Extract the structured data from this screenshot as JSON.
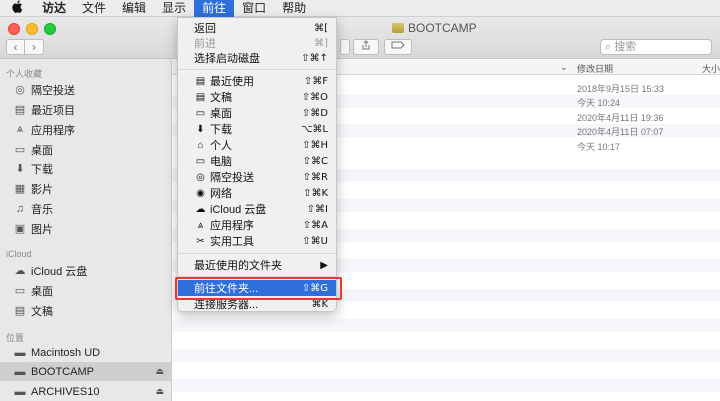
{
  "menubar": {
    "apple": "",
    "items": [
      "访达",
      "文件",
      "编辑",
      "显示",
      "前往",
      "窗口",
      "帮助"
    ]
  },
  "window": {
    "title": "BOOTCAMP",
    "search_placeholder": "搜索",
    "nav_back": "‹",
    "nav_forward": "›",
    "columns": {
      "date": "修改日期",
      "size": "大小"
    },
    "rows": [
      {
        "date": "2018年9月15日 15:33"
      },
      {
        "date": "今天 10:24"
      },
      {
        "date": "2020年4月11日 19:36"
      },
      {
        "date": "2020年4月11日 07:07"
      },
      {
        "date": "今天 10:17"
      }
    ]
  },
  "sidebar": {
    "favorites_title": "个人收藏",
    "favorites": [
      {
        "label": "隔空投送",
        "icon": "airdrop-icon"
      },
      {
        "label": "最近项目",
        "icon": "recents-icon"
      },
      {
        "label": "应用程序",
        "icon": "applications-icon"
      },
      {
        "label": "桌面",
        "icon": "desktop-icon"
      },
      {
        "label": "下载",
        "icon": "downloads-icon"
      },
      {
        "label": "影片",
        "icon": "movies-icon"
      },
      {
        "label": "音乐",
        "icon": "music-icon"
      },
      {
        "label": "图片",
        "icon": "pictures-icon"
      }
    ],
    "icloud_title": "iCloud",
    "icloud": [
      {
        "label": "iCloud 云盘",
        "icon": "cloud-icon"
      },
      {
        "label": "桌面",
        "icon": "desktop-icon"
      },
      {
        "label": "文稿",
        "icon": "documents-icon"
      }
    ],
    "locations_title": "位置",
    "locations": [
      {
        "label": "Macintosh UD",
        "icon": "drive-icon"
      },
      {
        "label": "BOOTCAMP",
        "icon": "drive-icon"
      },
      {
        "label": "ARCHIVES10",
        "icon": "drive-icon"
      }
    ],
    "eject": "⏏"
  },
  "menu": {
    "items": [
      {
        "label": "返回",
        "shortcut": "⌘[",
        "disabled": false
      },
      {
        "label": "前进",
        "shortcut": "⌘]",
        "disabled": true
      },
      {
        "label": "选择启动磁盘",
        "shortcut": "⇧⌘↑",
        "disabled": false
      },
      {
        "label": "最近使用",
        "shortcut": "⇧⌘F",
        "icon": "recents-icon"
      },
      {
        "label": "文稿",
        "shortcut": "⇧⌘O",
        "icon": "documents-icon"
      },
      {
        "label": "桌面",
        "shortcut": "⇧⌘D",
        "icon": "desktop-icon"
      },
      {
        "label": "下载",
        "shortcut": "⌥⌘L",
        "icon": "downloads-icon"
      },
      {
        "label": "个人",
        "shortcut": "⇧⌘H",
        "icon": "home-icon"
      },
      {
        "label": "电脑",
        "shortcut": "⇧⌘C",
        "icon": "computer-icon"
      },
      {
        "label": "隔空投送",
        "shortcut": "⇧⌘R",
        "icon": "airdrop-icon"
      },
      {
        "label": "网络",
        "shortcut": "⇧⌘K",
        "icon": "network-icon"
      },
      {
        "label": "iCloud 云盘",
        "shortcut": "⇧⌘I",
        "icon": "cloud-icon"
      },
      {
        "label": "应用程序",
        "shortcut": "⇧⌘A",
        "icon": "applications-icon"
      },
      {
        "label": "实用工具",
        "shortcut": "⇧⌘U",
        "icon": "utilities-icon"
      },
      {
        "label": "最近使用的文件夹",
        "shortcut": "▶"
      },
      {
        "label": "前往文件夹...",
        "shortcut": "⇧⌘G",
        "highlighted": true
      },
      {
        "label": "连接服务器...",
        "shortcut": "⌘K"
      }
    ]
  },
  "colors": {
    "accent": "#2f6fdb",
    "highlight_box": "#e5392f"
  }
}
